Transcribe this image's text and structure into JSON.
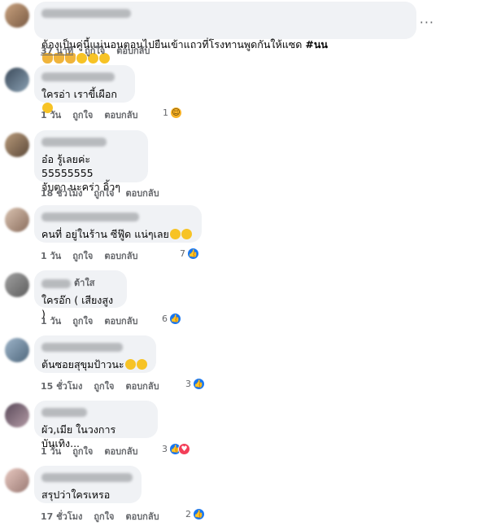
{
  "actions": {
    "like": "ถูกใจ",
    "reply": "ตอบกลับ"
  },
  "more_label": "···",
  "comments": [
    {
      "time": "37 นาที",
      "text_main": "ต้องเป็นคู่นี้แน่นอนตอนไปยืนเข้าแถวที่โรงทานพูดกันให้แซด ",
      "hashtag": "#นน",
      "reaction_count": ""
    },
    {
      "time": "1 วัน",
      "text": "ใครอ่า เราขี้เผือก",
      "reaction_count": "1"
    },
    {
      "time": "18 ชั่วโมง",
      "text": "อ๋อ รู้เลยค่ะ 55555555\nจับตา นะคร่า กิ้วๆ",
      "reaction_count": ""
    },
    {
      "time": "1 วัน",
      "text": "คนที่ อยู่ในร้าน ซีฟู๊ด แน่ๆเลย",
      "reaction_count": "7"
    },
    {
      "time": "1 วัน",
      "name_visible": "ต้าใส",
      "text": "ใครอ๊ก ( เสียงสูง )",
      "reaction_count": "6"
    },
    {
      "time": "15 ชั่วโมง",
      "text": "ต้นซอยสุขุมป้าวนะ",
      "reaction_count": "3"
    },
    {
      "time": "1 วัน",
      "text": "ผัว,เมีย ในวงการบันเทิง...",
      "reaction_count": "3"
    },
    {
      "time": "17 ชั่วโมง",
      "text": "สรุปว่าใครเหรอ",
      "reaction_count": "2"
    }
  ],
  "colors": {
    "bubble": "#f0f2f5",
    "meta": "#65676b",
    "like": "#1877f2",
    "love": "#f33e58"
  }
}
